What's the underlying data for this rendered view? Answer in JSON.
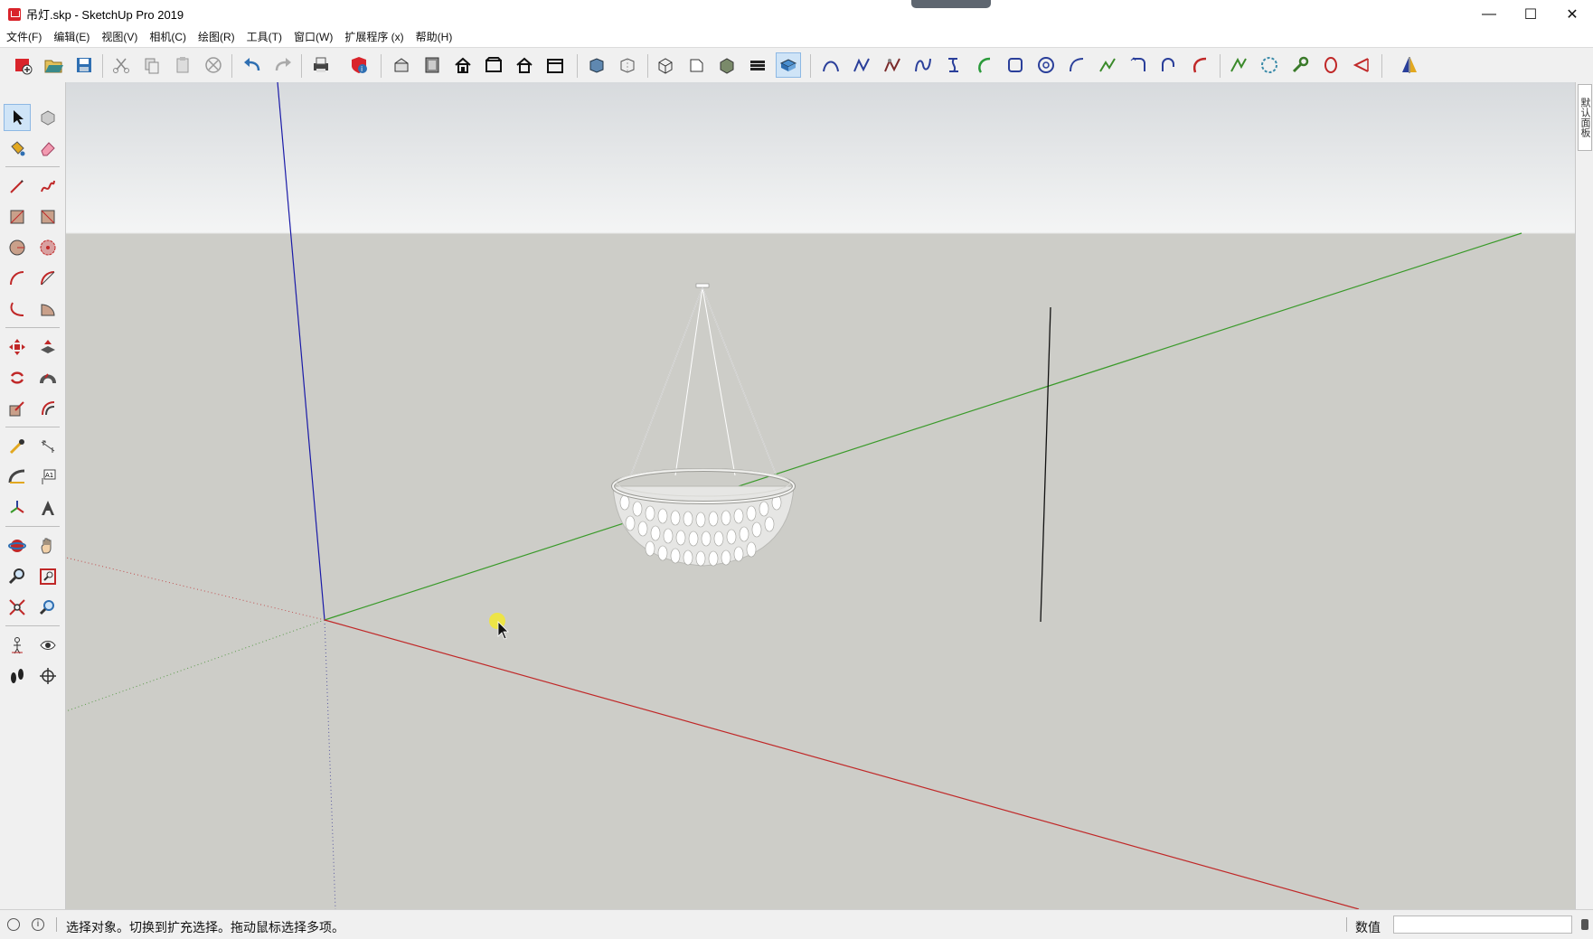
{
  "window": {
    "title": "吊灯.skp - SketchUp Pro 2019",
    "minimize": "—",
    "maximize": "☐",
    "close": "✕"
  },
  "menu": [
    {
      "label": "文件(F)"
    },
    {
      "label": "编辑(E)"
    },
    {
      "label": "视图(V)"
    },
    {
      "label": "相机(C)"
    },
    {
      "label": "绘图(R)"
    },
    {
      "label": "工具(T)"
    },
    {
      "label": "窗口(W)"
    },
    {
      "label": "扩展程序 (x)"
    },
    {
      "label": "帮助(H)"
    }
  ],
  "toolbar": {
    "icons": [
      "new-file-icon",
      "open-folder-icon",
      "save-icon",
      "cut-icon",
      "copy-icon",
      "paste-icon",
      "erase-icon",
      "undo-icon",
      "redo-icon",
      "print-icon",
      "model-info-icon",
      "iso-view-icon",
      "top-view-icon",
      "front-view-icon",
      "right-view-icon",
      "back-view-icon",
      "left-view-icon",
      "xray-icon",
      "back-edges-icon",
      "wireframe-icon",
      "hidden-line-icon",
      "shaded-icon",
      "shaded-textures-icon",
      "monochrome-icon",
      "bezier-curve-icon",
      "polyline-icon",
      "catmull-curve-icon",
      "cubic-bezier-icon",
      "spiral-icon",
      "arc-curve-icon",
      "rectangle-curve-icon",
      "circle-curve-icon",
      "arc-3pt-icon",
      "freehand-curve-icon",
      "fillet-icon",
      "arc-2pt-icon",
      "arc-bulge-icon",
      "smooth-curve-icon",
      "polygon-icon",
      "curve-tool-icon",
      "ellipse-icon",
      "pie-icon",
      "mirror-icon"
    ],
    "active": "shaded-textures-icon"
  },
  "palette": {
    "icons": [
      "select-icon",
      "component-icon",
      "paint-bucket-icon",
      "eraser-icon",
      "line-icon",
      "freehand-icon",
      "rectangle-icon",
      "rotated-rectangle-icon",
      "circle-icon",
      "polygon-icon",
      "arc-icon",
      "two-point-arc-icon",
      "three-point-arc-icon",
      "pie-icon",
      "move-icon",
      "push-pull-icon",
      "rotate-icon",
      "follow-me-icon",
      "scale-icon",
      "offset-icon",
      "tape-measure-icon",
      "dimension-icon",
      "protractor-icon",
      "text-icon",
      "axes-icon",
      "3d-text-icon",
      "orbit-icon",
      "pan-icon",
      "zoom-icon",
      "zoom-window-icon",
      "zoom-extents-icon",
      "previous-view-icon",
      "position-camera-icon",
      "look-around-icon",
      "walk-icon",
      "section-plane-icon"
    ],
    "text_tool_label": "A1",
    "active": "select-icon"
  },
  "tray": {
    "tab_label": "默认面板"
  },
  "colors": {
    "axis_blue": "#1a1aa8",
    "axis_green": "#3a9a2a",
    "axis_red": "#c02828",
    "ground": "#cdcdc8",
    "accent_active": "#cfe4f7"
  },
  "status": {
    "message": "选择对象。切换到扩充选择。拖动鼠标选择多项。",
    "measure_label": "数值",
    "measure_value": ""
  }
}
